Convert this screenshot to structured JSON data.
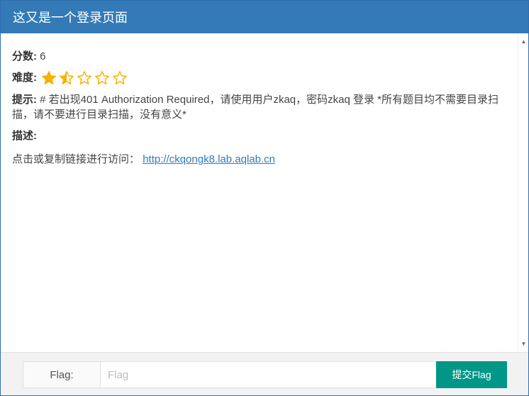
{
  "window": {
    "title": "这又是一个登录页面"
  },
  "challenge": {
    "score_label": "分数:",
    "score_value": "6",
    "difficulty_label": "难度:",
    "difficulty_rating": 1.5,
    "difficulty_max": 5,
    "hint_label": "提示:",
    "hint_text": "# 若出现401 Authorization Required，请使用用户zkaq，密码zkaq 登录 *所有题目均不需要目录扫描，请不要进行目录扫描，没有意义*",
    "desc_label": "描述:",
    "desc_prefix": "点击或复制链接进行访问：",
    "desc_link": "http://ckqongk8.lab.aqlab.cn"
  },
  "footer": {
    "flag_label": "Flag:",
    "flag_placeholder": "Flag",
    "flag_value": "",
    "submit_label": "提交Flag"
  },
  "colors": {
    "titlebar": "#337ab7",
    "star": "#f5b301",
    "submit": "#009688",
    "link": "#337ab7"
  }
}
